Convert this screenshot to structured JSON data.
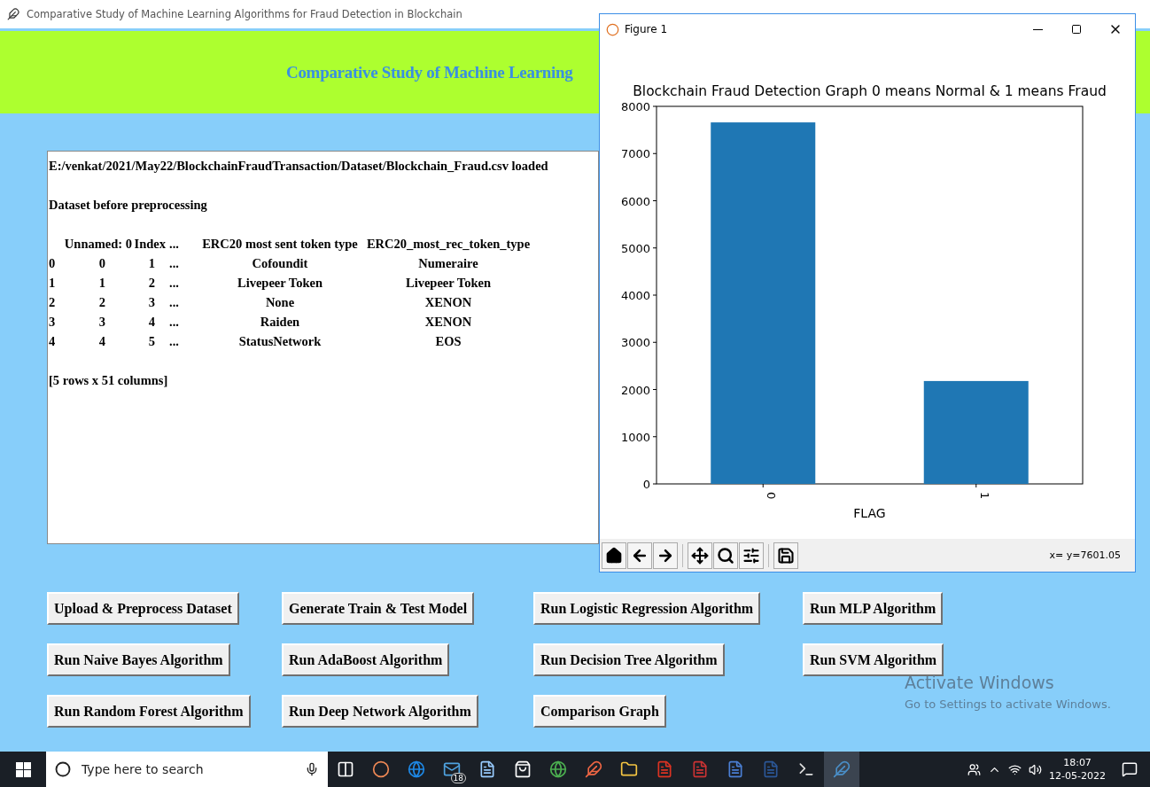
{
  "window": {
    "title": "Comparative Study of Machine Learning Algorithms for Fraud Detection in Blockchain"
  },
  "header": {
    "title": "Comparative Study of Machine Learning"
  },
  "output": {
    "lines_before": [
      "E:/venkat/2021/May22/BlockchainFraudTransaction/Dataset/Blockchain_Fraud.csv loaded",
      "Dataset before preprocessing"
    ],
    "table": {
      "columns": [
        "",
        "Unnamed: 0",
        "Index",
        "...",
        "ERC20 most sent token type",
        "ERC20_most_rec_token_type"
      ],
      "rows": [
        [
          "0",
          "0",
          "1",
          "...",
          "Cofoundit",
          "Numeraire"
        ],
        [
          "1",
          "1",
          "2",
          "...",
          "Livepeer Token",
          "Livepeer Token"
        ],
        [
          "2",
          "2",
          "3",
          "...",
          "None",
          "XENON"
        ],
        [
          "3",
          "3",
          "4",
          "...",
          "Raiden",
          "XENON"
        ],
        [
          "4",
          "4",
          "5",
          "...",
          "StatusNetwork",
          "EOS"
        ]
      ]
    },
    "lines_after": [
      "[5 rows x 51 columns]"
    ]
  },
  "buttons": [
    "Upload & Preprocess Dataset",
    "Generate Train & Test Model",
    "Run Logistic Regression Algorithm",
    "Run MLP Algorithm",
    "Run Naive Bayes Algorithm",
    "Run AdaBoost Algorithm",
    "Run Decision Tree Algorithm",
    "Run SVM Algorithm",
    "Run Random Forest Algorithm",
    "Run Deep Network Algorithm",
    "Comparison Graph"
  ],
  "figure": {
    "title": "Figure 1",
    "chart_data": {
      "type": "bar",
      "title": "Blockchain Fraud Detection Graph 0 means Normal & 1 means Fraud",
      "xlabel": "FLAG",
      "categories": [
        "0",
        "1"
      ],
      "series": [
        {
          "color": "#1f77b4",
          "values": [
            7660,
            2180
          ]
        }
      ],
      "ylim": [
        0,
        8000
      ],
      "yticks": [
        0,
        1000,
        2000,
        3000,
        4000,
        5000,
        6000,
        7000,
        8000
      ]
    },
    "coordinates": "x= y=7601.05"
  },
  "os_notice": {
    "title": "Activate Windows",
    "subtitle": "Go to Settings to activate Windows."
  },
  "taskbar": {
    "search": {
      "placeholder": "Type here to search"
    },
    "mail_badge": "18",
    "time": "18:07",
    "date": "12-05-2022"
  }
}
